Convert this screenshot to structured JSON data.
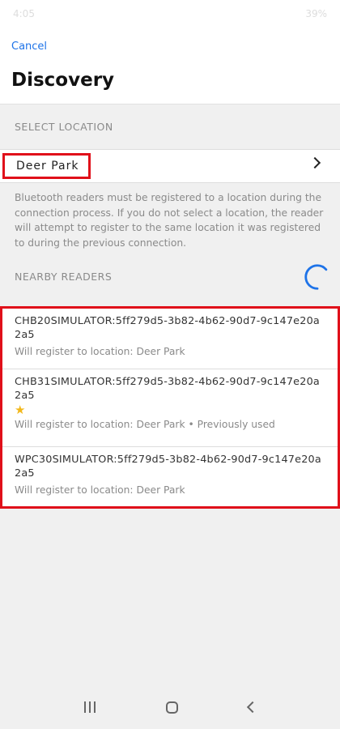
{
  "status_bar": {
    "time": "4:05",
    "battery": "39%"
  },
  "header": {
    "cancel_label": "Cancel",
    "title": "Discovery"
  },
  "select_location": {
    "section_label": "SELECT LOCATION",
    "selected_location": "Deer Park"
  },
  "info_text": "Bluetooth readers must be registered to a location during the connection process. If you do not select a location, the reader will attempt to register to the same location it was registered to during the previous connection.",
  "nearby": {
    "section_label": "NEARBY READERS"
  },
  "readers": [
    {
      "id": "CHB20SIMULATOR:5ff279d5-3b82-4b62-90d7-9c147e20a2a5",
      "subtitle": "Will register to location: Deer Park"
    },
    {
      "id": "CHB31SIMULATOR:5ff279d5-3b82-4b62-90d7-9c147e20a2a5",
      "subtitle": "Will register to location: Deer Park • Previously used",
      "starred": true
    },
    {
      "id": "WPC30SIMULATOR:5ff279d5-3b82-4b62-90d7-9c147e20a2a5",
      "subtitle": "Will register to location: Deer Park"
    }
  ],
  "colors": {
    "accent": "#1e73e8",
    "highlight": "#e0101a",
    "star": "#f2b81b"
  },
  "icons": {
    "star": "star-icon",
    "chevron": "chevron-right-icon",
    "spinner": "loading-spinner"
  }
}
